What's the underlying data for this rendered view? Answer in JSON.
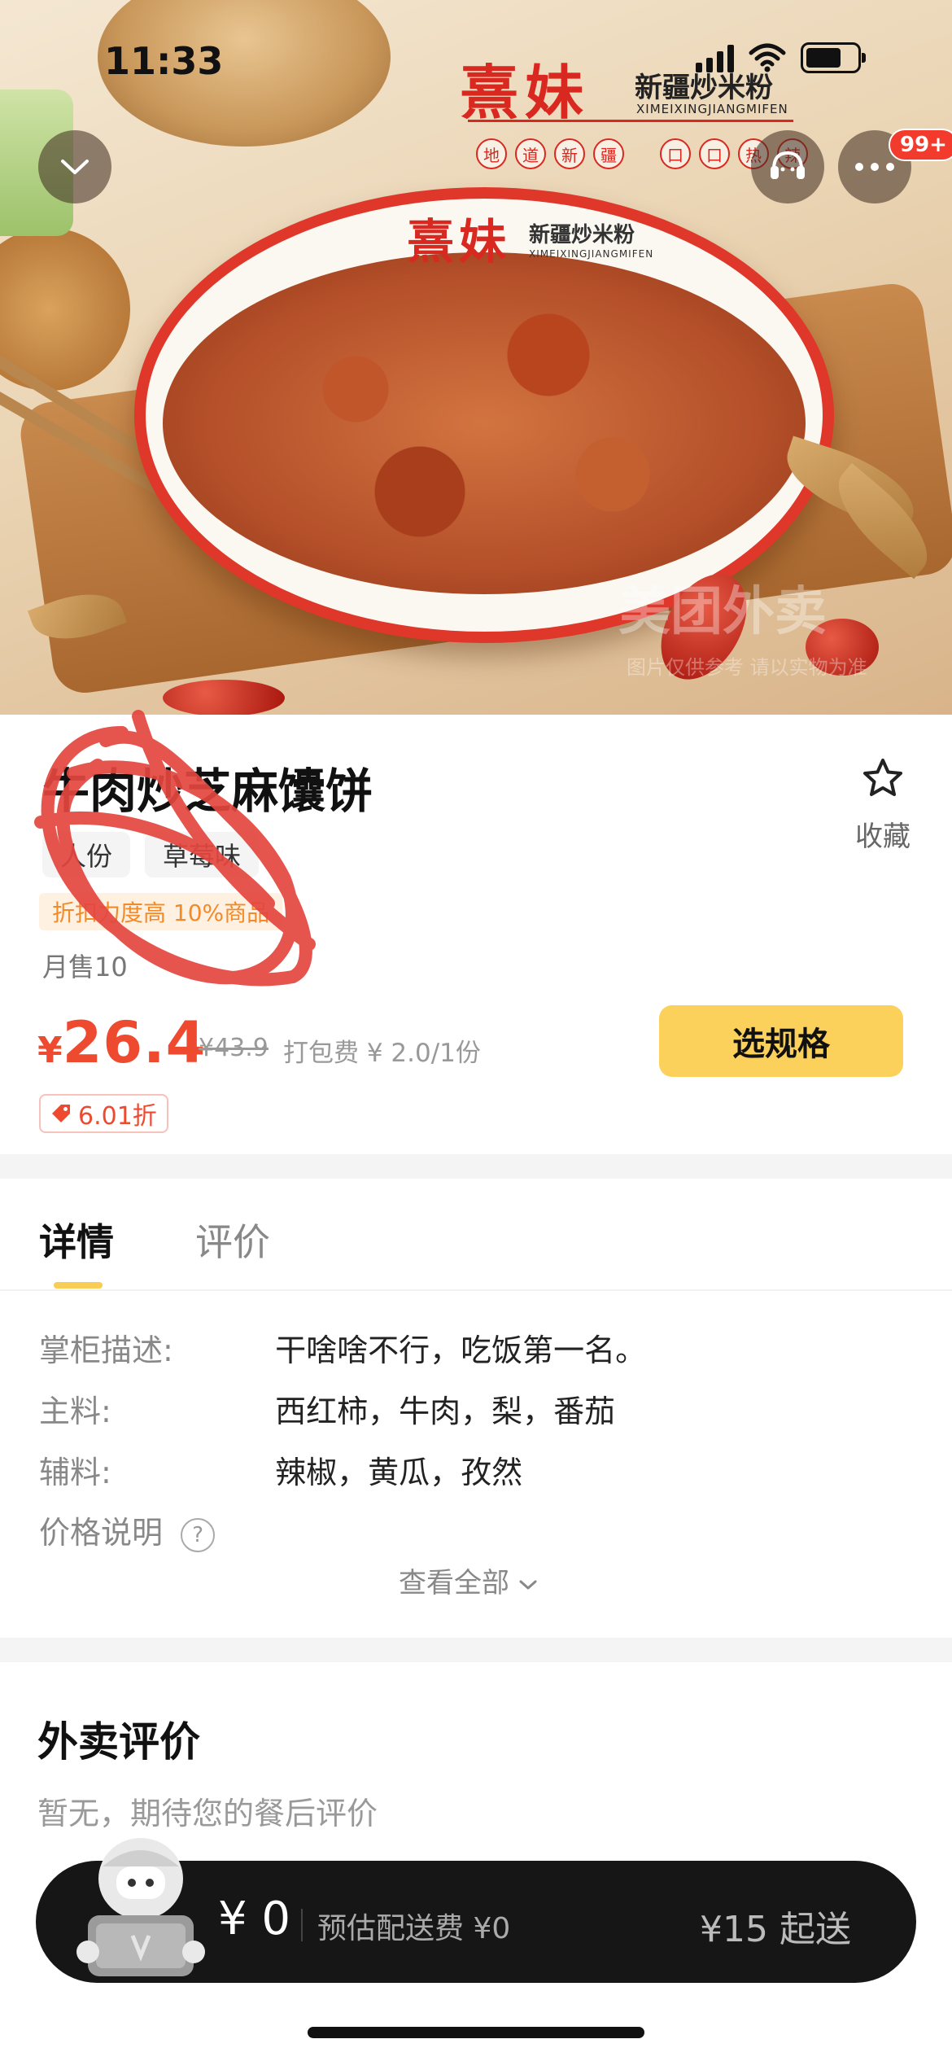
{
  "status_bar": {
    "time": "11:33"
  },
  "hero": {
    "brand_cn": "熹妹",
    "brand_sub": "新疆炒米粉",
    "brand_en": "XIMEIXINGJIANGMIFEN",
    "brand_tags": [
      "地",
      "道",
      "新",
      "疆",
      "口",
      "口",
      "热",
      "辣"
    ],
    "watermark": "美团外卖",
    "watermark_sub": "图片仅供参考 请以实物为准"
  },
  "header": {
    "more_badge": "99+"
  },
  "product": {
    "title": "牛肉炒芝麻馕饼",
    "favorite_label": "收藏",
    "tags": [
      "人份",
      "草莓味"
    ],
    "promo": "折扣力度高 10%商品",
    "monthly_sales": "月售10",
    "currency": "¥",
    "price": "26.4",
    "original_price": "¥43.9",
    "packing_fee": "打包费 ¥ 2.0/1份",
    "discount": "6.01折",
    "select_button": "选规格"
  },
  "tabs": [
    {
      "label": "详情",
      "active": true
    },
    {
      "label": "评价",
      "active": false
    }
  ],
  "details": {
    "rows": [
      {
        "key": "掌柜描述:",
        "value": "干啥啥不行，吃饭第一名。"
      },
      {
        "key": "主料:",
        "value": "西红柿，牛肉，梨，番茄"
      },
      {
        "key": "辅料:",
        "value": "辣椒，黄瓜，孜然"
      },
      {
        "key": "价格说明",
        "value": ""
      }
    ],
    "view_all": "查看全部"
  },
  "reviews": {
    "title": "外卖评价",
    "empty_text": "暂无，期待您的餐后评价"
  },
  "cart": {
    "total": "¥ 0",
    "delivery_fee": "预估配送费 ¥0",
    "min_order": "¥15 起送"
  },
  "colors": {
    "accent_yellow": "#fbd15b",
    "price_red": "#ee4a30",
    "cart_bg": "#161616",
    "brand_red": "#d8281f"
  },
  "icons": {
    "back": "chevron-down-icon",
    "support": "customer-service-icon",
    "more": "more-dots-icon",
    "favorite": "star-outline-icon",
    "discount": "price-tag-icon",
    "help": "question-mark-icon",
    "expand": "chevron-down-icon"
  }
}
